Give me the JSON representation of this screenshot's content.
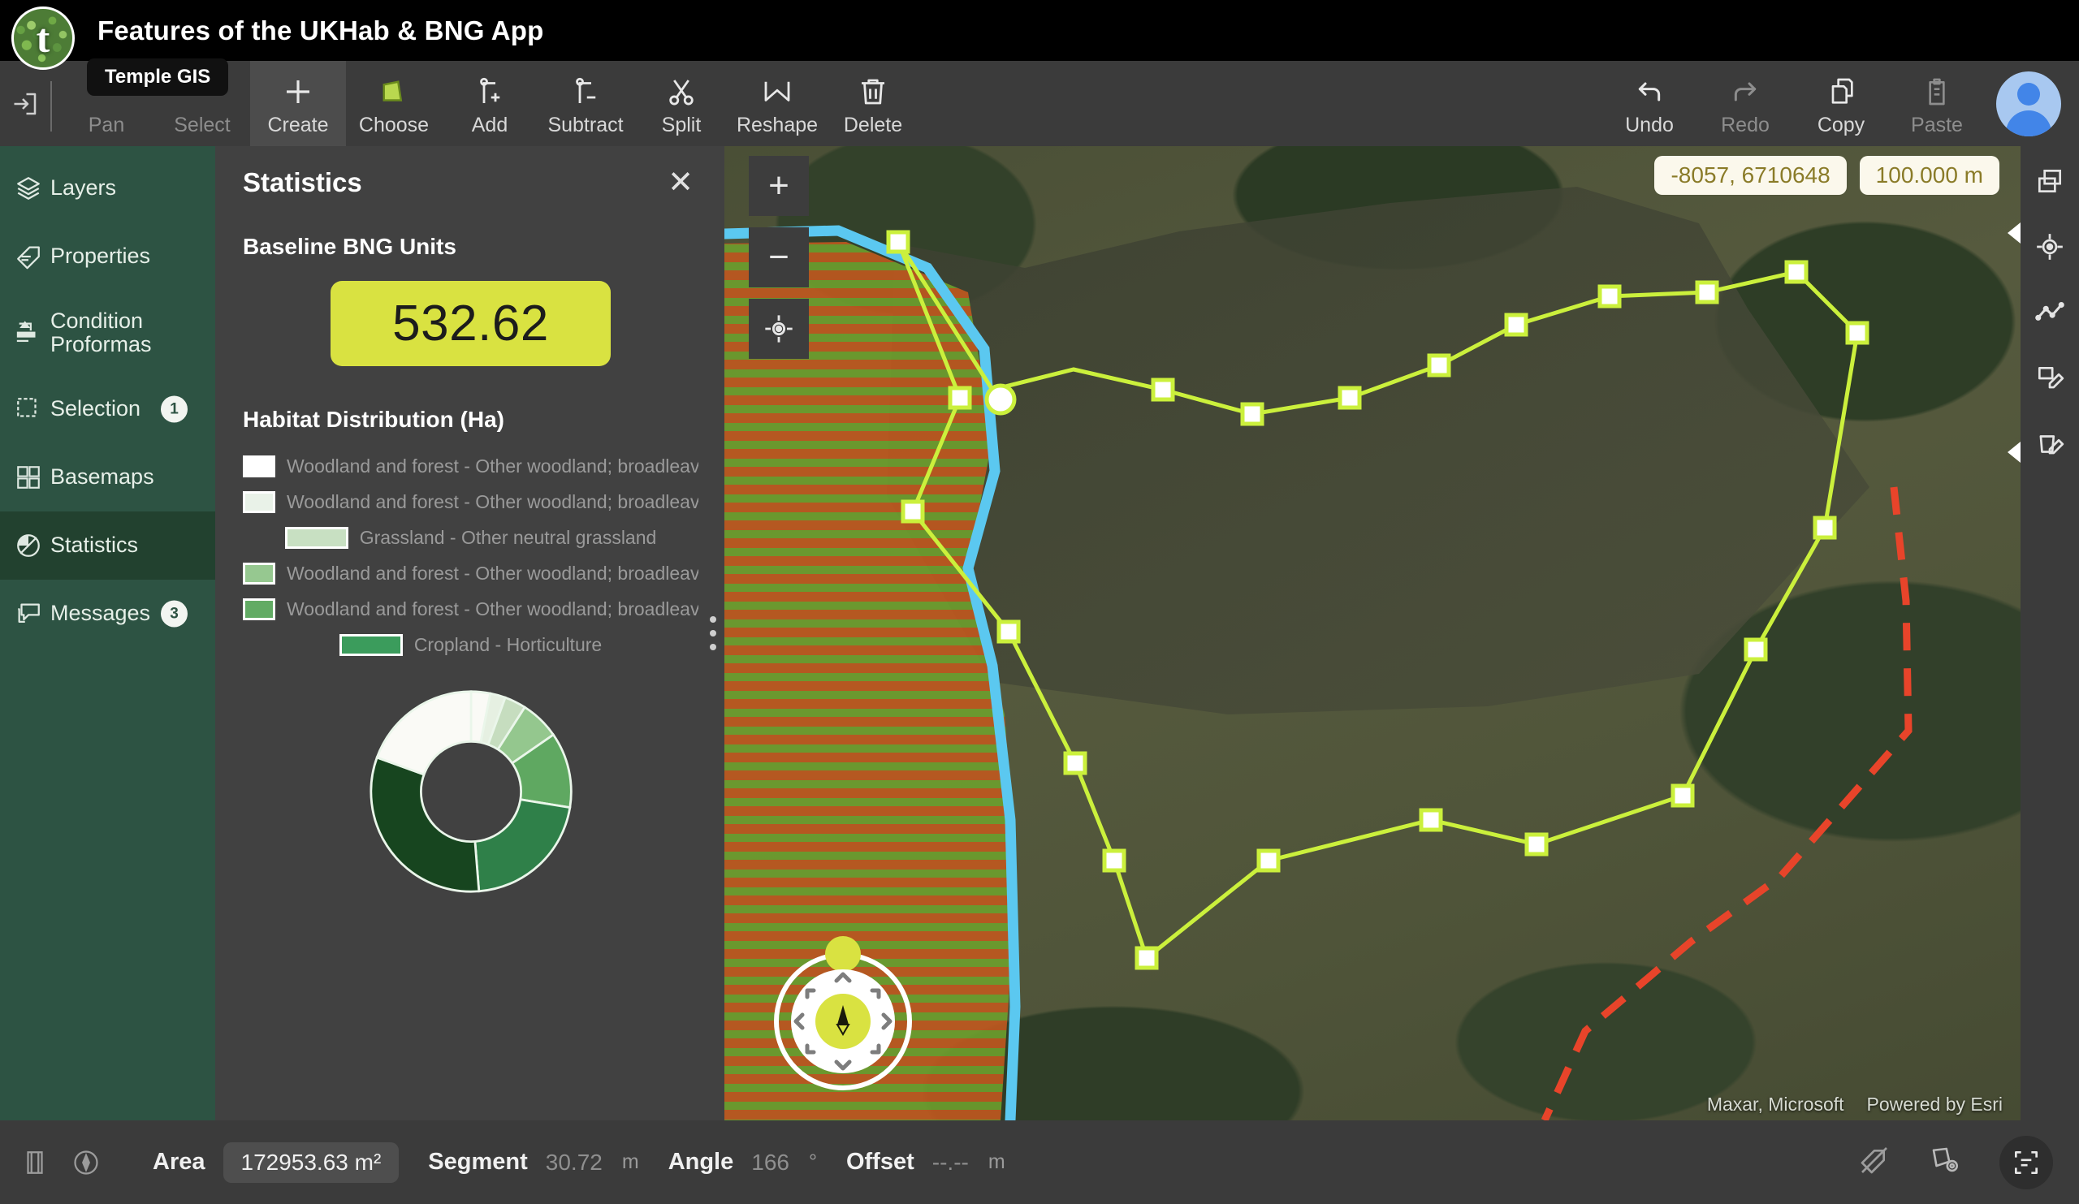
{
  "app": {
    "title": "Features of the UKHab & BNG App",
    "logo_letter": "t",
    "tooltip": "Temple GIS"
  },
  "toolbar": {
    "left_tools": [
      {
        "label": "Pan",
        "icon": "hand-icon",
        "active": false,
        "enabled": true
      },
      {
        "label": "Select",
        "icon": "cursor-icon",
        "active": false,
        "enabled": true
      },
      {
        "label": "Create",
        "icon": "plus-icon",
        "active": true,
        "enabled": true
      },
      {
        "label": "Choose",
        "icon": "polygon-icon",
        "active": false,
        "enabled": true
      },
      {
        "label": "Add",
        "icon": "vertex-add-icon",
        "active": false,
        "enabled": true
      },
      {
        "label": "Subtract",
        "icon": "vertex-sub-icon",
        "active": false,
        "enabled": true
      },
      {
        "label": "Split",
        "icon": "scissors-icon",
        "active": false,
        "enabled": true
      },
      {
        "label": "Reshape",
        "icon": "reshape-icon",
        "active": false,
        "enabled": true
      },
      {
        "label": "Delete",
        "icon": "trash-icon",
        "active": false,
        "enabled": true
      }
    ],
    "right_tools": [
      {
        "label": "Undo",
        "icon": "undo-icon",
        "enabled": true
      },
      {
        "label": "Redo",
        "icon": "redo-icon",
        "enabled": false
      },
      {
        "label": "Copy",
        "icon": "copy-icon",
        "enabled": true
      },
      {
        "label": "Paste",
        "icon": "paste-icon",
        "enabled": false
      }
    ]
  },
  "sidebar": {
    "items": [
      {
        "label": "Layers",
        "icon": "layers-icon",
        "badge": "",
        "active": false
      },
      {
        "label": "Properties",
        "icon": "properties-icon",
        "badge": "",
        "active": false
      },
      {
        "label": "Condition Proformas",
        "icon": "proforma-icon",
        "badge": "",
        "active": false
      },
      {
        "label": "Selection",
        "icon": "selection-icon",
        "badge": "1",
        "active": false
      },
      {
        "label": "Basemaps",
        "icon": "basemap-icon",
        "badge": "",
        "active": false
      },
      {
        "label": "Statistics",
        "icon": "statistics-icon",
        "badge": "",
        "active": true
      },
      {
        "label": "Messages",
        "icon": "messages-icon",
        "badge": "3",
        "active": false
      }
    ]
  },
  "panel": {
    "title": "Statistics",
    "close_label": "✕",
    "bng_section_title": "Baseline BNG Units",
    "bng_value": "532.62",
    "bng_color": "#d9e241",
    "habitat_section_title": "Habitat Distribution (Ha)"
  },
  "chart_data": {
    "type": "pie",
    "title": "Habitat Distribution (Ha)",
    "legend_position": "top",
    "categories": [
      "Woodland and forest - Other woodland; broadleaved",
      "Woodland and forest - Other woodland; broadleaved",
      "Grassland - Other neutral grassland",
      "Woodland and forest - Other woodland; broadleaved",
      "Woodland and forest - Other woodland; broadleaved",
      "Cropland - Horticulture",
      "Woodland and forest - Other woodland; broadleaved"
    ],
    "values": [
      37.0,
      2.5,
      3.5,
      7.0,
      12.0,
      17.0,
      21.0
    ],
    "colors": [
      "#fafaf6",
      "#e6f0e2",
      "#c6ddbf",
      "#94c78e",
      "#5fa861",
      "#2f8049",
      "#17451f"
    ],
    "swatch_colors": [
      "#ffffff",
      "#e9f2e8",
      "#c8e0c2",
      "#96c890",
      "#62ab64",
      "#3b9c5c",
      "#17451f"
    ],
    "xlabel": "",
    "ylabel": "",
    "grid": false
  },
  "map": {
    "coordinates_badge": "-8057, 6710648",
    "scale_badge": "100.000 m",
    "attribution_source": "Maxar, Microsoft",
    "attribution_provider": "Powered by Esri",
    "zoom_in_label": "+",
    "zoom_out_label": "−",
    "locate_icon": "crosshair-icon"
  },
  "rail": {
    "items": [
      {
        "icon": "duplicate-icon"
      },
      {
        "icon": "target-icon"
      },
      {
        "icon": "line-chart-icon"
      },
      {
        "icon": "edit-shape-icon"
      },
      {
        "icon": "delete-shape-icon"
      }
    ]
  },
  "status": {
    "area_label": "Area",
    "area_value": "172953.63 m²",
    "segment_label": "Segment",
    "segment_value": "30.72",
    "segment_unit": "m",
    "angle_label": "Angle",
    "angle_value": "166",
    "angle_unit": "°",
    "offset_label": "Offset",
    "offset_value": "--.--",
    "offset_unit": "m",
    "right_icons": [
      "hide-layer-icon",
      "shape-settings-icon",
      "scan-icon"
    ]
  }
}
